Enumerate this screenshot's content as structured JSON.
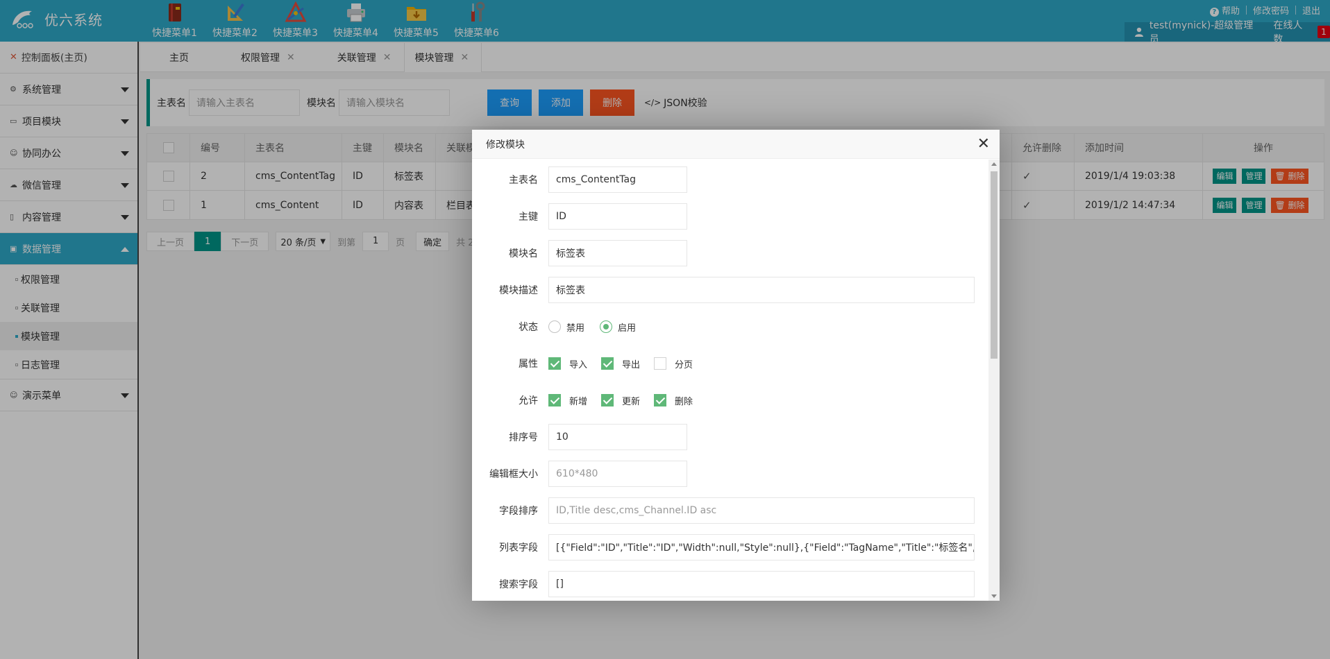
{
  "header": {
    "logo_text": "优六系统",
    "quick_menus": [
      "快捷菜单1",
      "快捷菜单2",
      "快捷菜单3",
      "快捷菜单4",
      "快捷菜单5",
      "快捷菜单6"
    ],
    "help": "帮助",
    "change_password": "修改密码",
    "logout": "退出",
    "user": "test(mynick)-超级管理员",
    "online_label": "在线人数",
    "online_count": "1"
  },
  "sidebar": {
    "dashboard": "控制面板(主页)",
    "items": [
      "系统管理",
      "项目模块",
      "协同办公",
      "微信管理",
      "内容管理",
      "数据管理"
    ],
    "sub_items": [
      "权限管理",
      "关联管理",
      "模块管理",
      "日志管理"
    ],
    "last_item": "演示菜单"
  },
  "tabs": [
    "主页",
    "权限管理",
    "关联管理",
    "模块管理"
  ],
  "search": {
    "main_table_label": "主表名",
    "main_table_placeholder": "请输入主表名",
    "module_label": "模块名",
    "module_placeholder": "请输入模块名",
    "query": "查询",
    "add": "添加",
    "delete": "删除",
    "json_check": "JSON校验"
  },
  "table": {
    "headers": [
      "编号",
      "主表名",
      "主键",
      "模块名",
      "关联模",
      "允许删除",
      "添加时间",
      "操作"
    ],
    "rows": [
      {
        "id": "2",
        "main_table": "cms_ContentTag",
        "key": "ID",
        "module": "标签表",
        "rel": "",
        "time": "2019/1/4 19:03:38"
      },
      {
        "id": "1",
        "main_table": "cms_Content",
        "key": "ID",
        "module": "内容表",
        "rel": "栏目表",
        "time": "2019/1/2 14:47:34"
      }
    ],
    "actions": {
      "edit": "编辑",
      "manage": "管理",
      "delete": "删除"
    }
  },
  "pager": {
    "prev": "上一页",
    "current": "1",
    "next": "下一页",
    "per_page": "20 条/页",
    "goto": "到第",
    "page_value": "1",
    "page": "页",
    "ok": "确定",
    "total": "共 2"
  },
  "modal": {
    "title": "修改模块",
    "fields": {
      "main_table": {
        "label": "主表名",
        "value": "cms_ContentTag"
      },
      "key": {
        "label": "主键",
        "value": "ID"
      },
      "module": {
        "label": "模块名",
        "value": "标签表"
      },
      "desc": {
        "label": "模块描述",
        "value": "标签表"
      },
      "status": {
        "label": "状态",
        "options": [
          "禁用",
          "启用"
        ],
        "selected": "启用"
      },
      "attr": {
        "label": "属性",
        "options": [
          "导入",
          "导出",
          "分页"
        ],
        "checked": [
          "导入",
          "导出"
        ]
      },
      "allow": {
        "label": "允许",
        "options": [
          "新增",
          "更新",
          "删除"
        ],
        "checked": [
          "新增",
          "更新",
          "删除"
        ]
      },
      "sort": {
        "label": "排序号",
        "value": "10"
      },
      "size": {
        "label": "编辑框大小",
        "placeholder": "610*480"
      },
      "field_sort": {
        "label": "字段排序",
        "placeholder": "ID,Title desc,cms_Channel.ID asc"
      },
      "list_fields": {
        "label": "列表字段",
        "value": "[{\"Field\":\"ID\",\"Title\":\"ID\",\"Width\":null,\"Style\":null},{\"Field\":\"TagName\",\"Title\":\"标签名\",\"Width\":null,\"Style\":null}]"
      },
      "search_fields": {
        "label": "搜索字段",
        "value": "[]"
      }
    }
  },
  "colors": {
    "header": "#2fa9c9",
    "teal": "#009688",
    "blue": "#1e9fff",
    "red": "#ff5722",
    "green": "#5fb878"
  }
}
